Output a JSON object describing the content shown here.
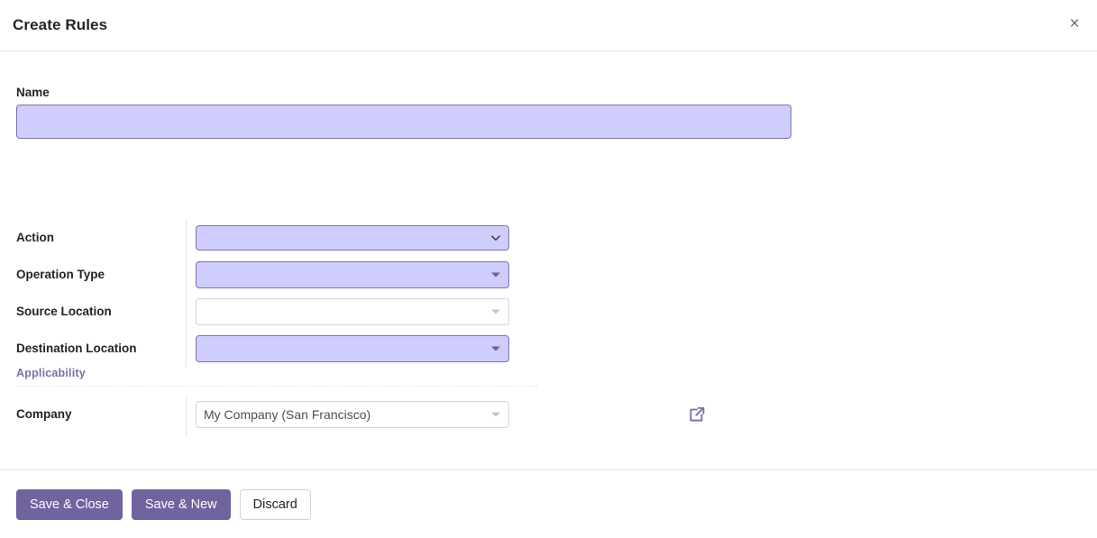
{
  "dialog": {
    "title": "Create Rules",
    "close_label": "×",
    "close_icon": "close-icon"
  },
  "form": {
    "name": {
      "label": "Name",
      "value": "",
      "placeholder": ""
    },
    "fields": [
      {
        "key": "action",
        "label": "Action",
        "value": "",
        "placeholder": "",
        "state": "filled",
        "icon": "chevron-down-icon"
      },
      {
        "key": "operation_type",
        "label": "Operation Type",
        "value": "",
        "placeholder": "",
        "state": "filled",
        "icon": "caret-down-icon"
      },
      {
        "key": "source_location",
        "label": "Source Location",
        "value": "",
        "placeholder": "",
        "state": "empty",
        "icon": "caret-down-icon"
      },
      {
        "key": "destination_location",
        "label": "Destination Location",
        "value": "",
        "placeholder": "",
        "state": "filled",
        "icon": "caret-down-icon"
      }
    ]
  },
  "applicability": {
    "section_title": "Applicability",
    "company": {
      "label": "Company",
      "value": "My Company (San Francisco)",
      "placeholder": "",
      "state": "empty",
      "icon": "caret-down-icon",
      "external_link_icon": "external-link-icon"
    }
  },
  "footer": {
    "save_close_label": "Save & Close",
    "save_new_label": "Save & New",
    "discard_label": "Discard"
  },
  "colors": {
    "accent_purple": "#71639e",
    "field_fill": "#cfcdfc",
    "field_border": "#7d6fae",
    "section_title": "#7a6fa8",
    "divider": "#dee2e6"
  }
}
